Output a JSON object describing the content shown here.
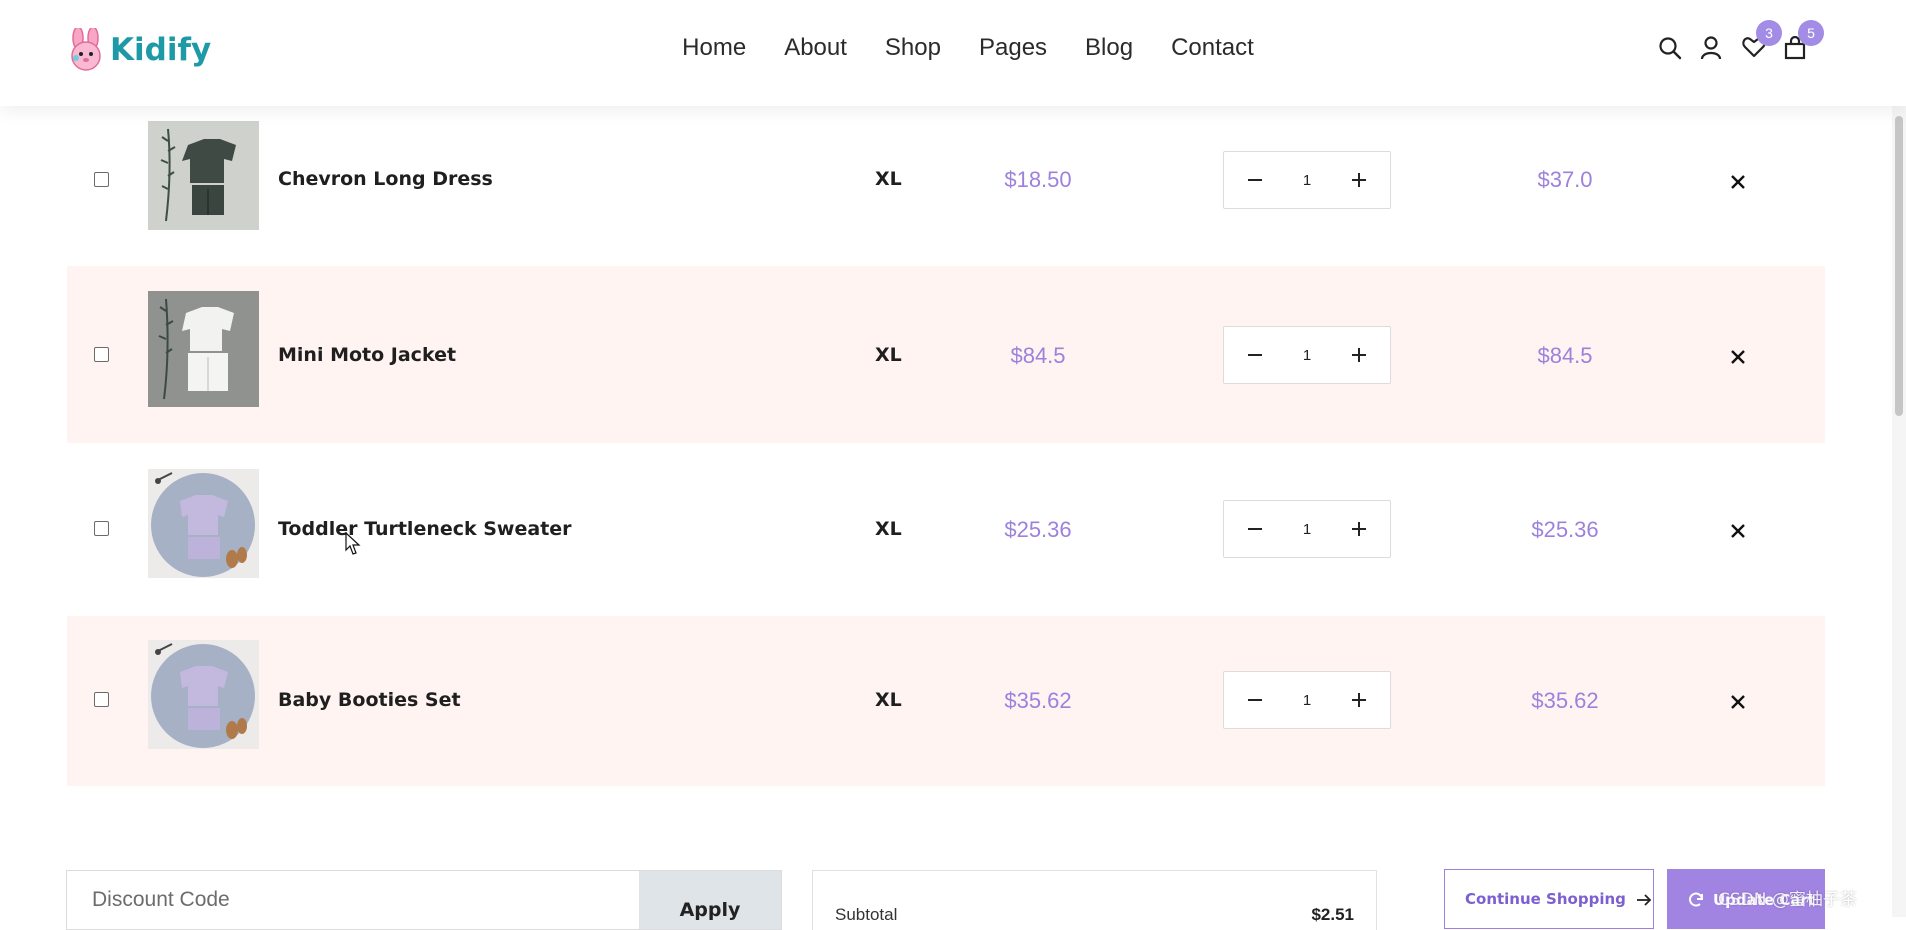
{
  "header": {
    "logo_text": "Kidify",
    "nav": [
      "Home",
      "About",
      "Shop",
      "Pages",
      "Blog",
      "Contact"
    ],
    "icons": {
      "search": "search-icon",
      "user": "user-icon",
      "wishlist": "heart-icon",
      "cart": "shopping-bag-icon"
    },
    "wishlist_count": "3",
    "cart_count": "5"
  },
  "cart": {
    "items": [
      {
        "name": "Chevron Long Dress",
        "size": "XL",
        "price": "$18.50",
        "quantity": "1",
        "total": "$37.0"
      },
      {
        "name": "Mini Moto Jacket",
        "size": "XL",
        "price": "$84.5",
        "quantity": "1",
        "total": "$84.5"
      },
      {
        "name": "Toddler Turtleneck Sweater",
        "size": "XL",
        "price": "$25.36",
        "quantity": "1",
        "total": "$25.36"
      },
      {
        "name": "Baby Booties Set",
        "size": "XL",
        "price": "$35.62",
        "quantity": "1",
        "total": "$35.62"
      }
    ]
  },
  "discount": {
    "placeholder": "Discount Code",
    "apply_label": "Apply"
  },
  "summary": {
    "subtotal_label": "Subtotal",
    "subtotal_value": "$2.51"
  },
  "actions": {
    "continue_label": "Continue Shopping",
    "update_label": "Update Cart"
  },
  "watermark": "CSDN @蜜柚子茶",
  "colors": {
    "accent": "#a28ce6",
    "price": "#9d81dc",
    "row_alt_bg": "#fff4f2",
    "logo": "#1e9aa6"
  }
}
